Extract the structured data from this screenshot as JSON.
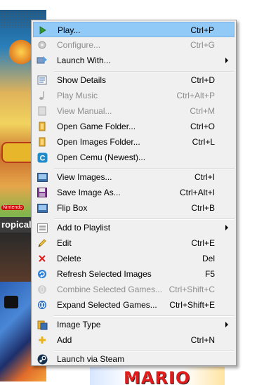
{
  "background": {
    "caption": "ropical",
    "nintendo_badge": "Nintendo",
    "mario_logo": "MARIO"
  },
  "menu": {
    "items": [
      {
        "label": "Play...",
        "shortcut": "Ctrl+P",
        "icon": "play-icon",
        "disabled": false,
        "submenu": false,
        "highlighted": true
      },
      {
        "label": "Configure...",
        "shortcut": "Ctrl+G",
        "icon": "gear-icon",
        "disabled": true,
        "submenu": false
      },
      {
        "label": "Launch With...",
        "shortcut": "",
        "icon": "launch-icon",
        "disabled": false,
        "submenu": true
      },
      {
        "label": "Show Details",
        "shortcut": "Ctrl+D",
        "icon": "details-icon",
        "disabled": false,
        "submenu": false
      },
      {
        "label": "Play Music",
        "shortcut": "Ctrl+Alt+P",
        "icon": "music-note-icon",
        "disabled": true,
        "submenu": false
      },
      {
        "label": "View Manual...",
        "shortcut": "Ctrl+M",
        "icon": "manual-icon",
        "disabled": true,
        "submenu": false
      },
      {
        "label": "Open Game Folder...",
        "shortcut": "Ctrl+O",
        "icon": "folder-icon",
        "disabled": false,
        "submenu": false
      },
      {
        "label": "Open Images Folder...",
        "shortcut": "Ctrl+L",
        "icon": "folder-icon",
        "disabled": false,
        "submenu": false
      },
      {
        "label": "Open Cemu (Newest)...",
        "shortcut": "",
        "icon": "cemu-icon",
        "disabled": false,
        "submenu": false
      },
      {
        "label": "View Images...",
        "shortcut": "Ctrl+I",
        "icon": "image-icon",
        "disabled": false,
        "submenu": false
      },
      {
        "label": "Save Image As...",
        "shortcut": "Ctrl+Alt+I",
        "icon": "save-icon",
        "disabled": false,
        "submenu": false
      },
      {
        "label": "Flip Box",
        "shortcut": "Ctrl+B",
        "icon": "flip-icon",
        "disabled": false,
        "submenu": false
      },
      {
        "label": "Add to Playlist",
        "shortcut": "",
        "icon": "playlist-icon",
        "disabled": false,
        "submenu": true
      },
      {
        "label": "Edit",
        "shortcut": "Ctrl+E",
        "icon": "pencil-icon",
        "disabled": false,
        "submenu": false
      },
      {
        "label": "Delete",
        "shortcut": "Del",
        "icon": "delete-icon",
        "disabled": false,
        "submenu": false
      },
      {
        "label": "Refresh Selected Images",
        "shortcut": "F5",
        "icon": "refresh-icon",
        "disabled": false,
        "submenu": false
      },
      {
        "label": "Combine Selected Games...",
        "shortcut": "Ctrl+Shift+C",
        "icon": "combine-icon",
        "disabled": true,
        "submenu": false
      },
      {
        "label": "Expand Selected Games...",
        "shortcut": "Ctrl+Shift+E",
        "icon": "expand-icon",
        "disabled": false,
        "submenu": false
      },
      {
        "label": "Image Type",
        "shortcut": "",
        "icon": "image-type-icon",
        "disabled": false,
        "submenu": true
      },
      {
        "label": "Add",
        "shortcut": "Ctrl+N",
        "icon": "add-icon",
        "disabled": false,
        "submenu": false
      },
      {
        "label": "Launch via Steam",
        "shortcut": "",
        "icon": "steam-icon",
        "disabled": false,
        "submenu": false
      }
    ]
  },
  "colors": {
    "highlight": "#91c9f7",
    "menu_bg": "#f0f0f0",
    "disabled_text": "#8d8d8d"
  }
}
